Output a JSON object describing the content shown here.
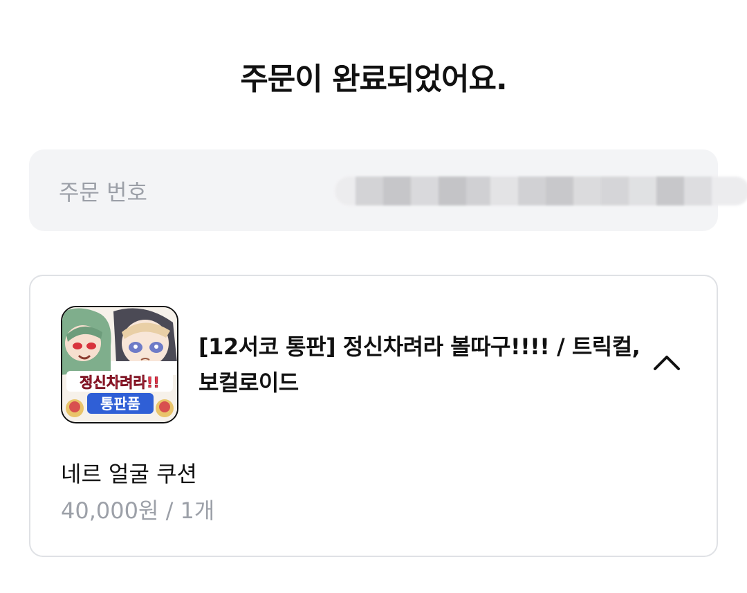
{
  "header": {
    "title": "주문이 완료되었어요."
  },
  "order": {
    "number_label": "주문 번호",
    "number_value": ""
  },
  "product": {
    "title": "[12서코 통판] 정신차려라 볼따구!!!! / 트릭컬, 보컬로이드",
    "thumbnail_text_top": "정신차려라!!",
    "thumbnail_text_bottom": "통판품",
    "option_name": "네르 얼굴 쿠션",
    "option_price": "40,000원 / 1개",
    "toggle_icon": "chevron-up-icon"
  },
  "colors": {
    "muted_text": "#9ca0a8",
    "box_bg": "#f3f4f6",
    "border": "#dfe1e5",
    "thumb_banner_red": "#e8364a",
    "thumb_banner_blue": "#2f5fd6"
  }
}
